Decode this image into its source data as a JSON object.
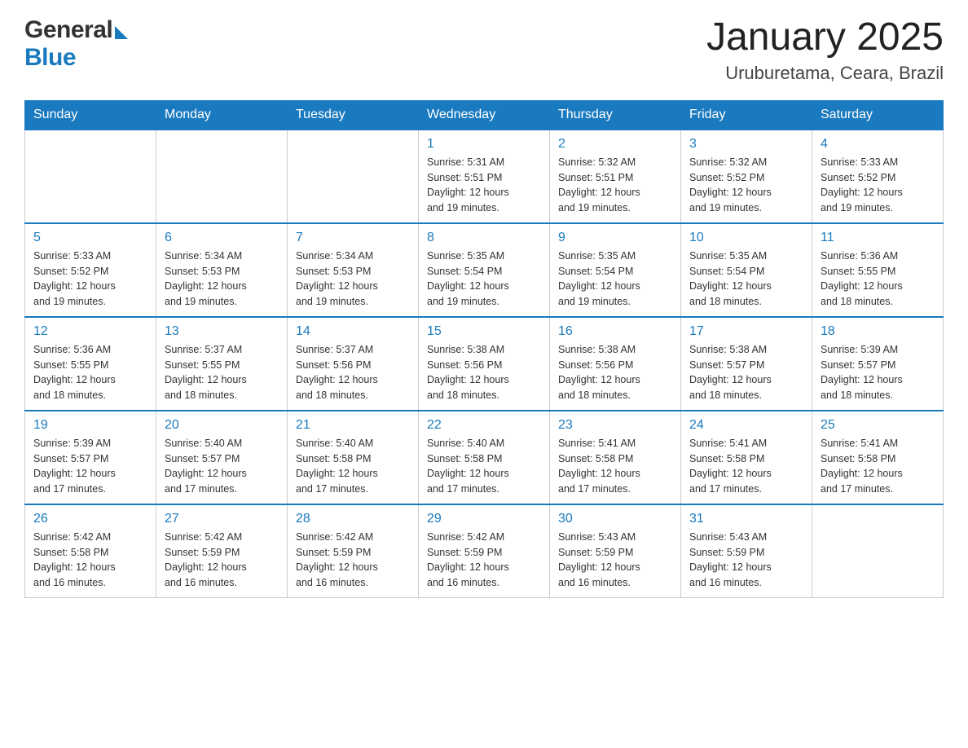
{
  "header": {
    "logo_general": "General",
    "logo_blue": "Blue",
    "title": "January 2025",
    "subtitle": "Uruburetama, Ceara, Brazil"
  },
  "days_of_week": [
    "Sunday",
    "Monday",
    "Tuesday",
    "Wednesday",
    "Thursday",
    "Friday",
    "Saturday"
  ],
  "weeks": [
    [
      {
        "day": "",
        "info": ""
      },
      {
        "day": "",
        "info": ""
      },
      {
        "day": "",
        "info": ""
      },
      {
        "day": "1",
        "info": "Sunrise: 5:31 AM\nSunset: 5:51 PM\nDaylight: 12 hours\nand 19 minutes."
      },
      {
        "day": "2",
        "info": "Sunrise: 5:32 AM\nSunset: 5:51 PM\nDaylight: 12 hours\nand 19 minutes."
      },
      {
        "day": "3",
        "info": "Sunrise: 5:32 AM\nSunset: 5:52 PM\nDaylight: 12 hours\nand 19 minutes."
      },
      {
        "day": "4",
        "info": "Sunrise: 5:33 AM\nSunset: 5:52 PM\nDaylight: 12 hours\nand 19 minutes."
      }
    ],
    [
      {
        "day": "5",
        "info": "Sunrise: 5:33 AM\nSunset: 5:52 PM\nDaylight: 12 hours\nand 19 minutes."
      },
      {
        "day": "6",
        "info": "Sunrise: 5:34 AM\nSunset: 5:53 PM\nDaylight: 12 hours\nand 19 minutes."
      },
      {
        "day": "7",
        "info": "Sunrise: 5:34 AM\nSunset: 5:53 PM\nDaylight: 12 hours\nand 19 minutes."
      },
      {
        "day": "8",
        "info": "Sunrise: 5:35 AM\nSunset: 5:54 PM\nDaylight: 12 hours\nand 19 minutes."
      },
      {
        "day": "9",
        "info": "Sunrise: 5:35 AM\nSunset: 5:54 PM\nDaylight: 12 hours\nand 19 minutes."
      },
      {
        "day": "10",
        "info": "Sunrise: 5:35 AM\nSunset: 5:54 PM\nDaylight: 12 hours\nand 18 minutes."
      },
      {
        "day": "11",
        "info": "Sunrise: 5:36 AM\nSunset: 5:55 PM\nDaylight: 12 hours\nand 18 minutes."
      }
    ],
    [
      {
        "day": "12",
        "info": "Sunrise: 5:36 AM\nSunset: 5:55 PM\nDaylight: 12 hours\nand 18 minutes."
      },
      {
        "day": "13",
        "info": "Sunrise: 5:37 AM\nSunset: 5:55 PM\nDaylight: 12 hours\nand 18 minutes."
      },
      {
        "day": "14",
        "info": "Sunrise: 5:37 AM\nSunset: 5:56 PM\nDaylight: 12 hours\nand 18 minutes."
      },
      {
        "day": "15",
        "info": "Sunrise: 5:38 AM\nSunset: 5:56 PM\nDaylight: 12 hours\nand 18 minutes."
      },
      {
        "day": "16",
        "info": "Sunrise: 5:38 AM\nSunset: 5:56 PM\nDaylight: 12 hours\nand 18 minutes."
      },
      {
        "day": "17",
        "info": "Sunrise: 5:38 AM\nSunset: 5:57 PM\nDaylight: 12 hours\nand 18 minutes."
      },
      {
        "day": "18",
        "info": "Sunrise: 5:39 AM\nSunset: 5:57 PM\nDaylight: 12 hours\nand 18 minutes."
      }
    ],
    [
      {
        "day": "19",
        "info": "Sunrise: 5:39 AM\nSunset: 5:57 PM\nDaylight: 12 hours\nand 17 minutes."
      },
      {
        "day": "20",
        "info": "Sunrise: 5:40 AM\nSunset: 5:57 PM\nDaylight: 12 hours\nand 17 minutes."
      },
      {
        "day": "21",
        "info": "Sunrise: 5:40 AM\nSunset: 5:58 PM\nDaylight: 12 hours\nand 17 minutes."
      },
      {
        "day": "22",
        "info": "Sunrise: 5:40 AM\nSunset: 5:58 PM\nDaylight: 12 hours\nand 17 minutes."
      },
      {
        "day": "23",
        "info": "Sunrise: 5:41 AM\nSunset: 5:58 PM\nDaylight: 12 hours\nand 17 minutes."
      },
      {
        "day": "24",
        "info": "Sunrise: 5:41 AM\nSunset: 5:58 PM\nDaylight: 12 hours\nand 17 minutes."
      },
      {
        "day": "25",
        "info": "Sunrise: 5:41 AM\nSunset: 5:58 PM\nDaylight: 12 hours\nand 17 minutes."
      }
    ],
    [
      {
        "day": "26",
        "info": "Sunrise: 5:42 AM\nSunset: 5:58 PM\nDaylight: 12 hours\nand 16 minutes."
      },
      {
        "day": "27",
        "info": "Sunrise: 5:42 AM\nSunset: 5:59 PM\nDaylight: 12 hours\nand 16 minutes."
      },
      {
        "day": "28",
        "info": "Sunrise: 5:42 AM\nSunset: 5:59 PM\nDaylight: 12 hours\nand 16 minutes."
      },
      {
        "day": "29",
        "info": "Sunrise: 5:42 AM\nSunset: 5:59 PM\nDaylight: 12 hours\nand 16 minutes."
      },
      {
        "day": "30",
        "info": "Sunrise: 5:43 AM\nSunset: 5:59 PM\nDaylight: 12 hours\nand 16 minutes."
      },
      {
        "day": "31",
        "info": "Sunrise: 5:43 AM\nSunset: 5:59 PM\nDaylight: 12 hours\nand 16 minutes."
      },
      {
        "day": "",
        "info": ""
      }
    ]
  ]
}
